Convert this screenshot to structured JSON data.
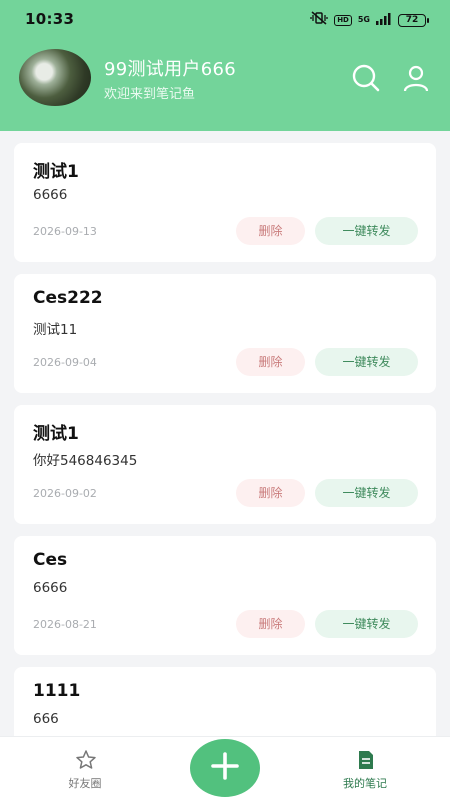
{
  "status_bar": {
    "time": "10:33",
    "network": "5G",
    "hd": "HD",
    "battery": "72"
  },
  "header": {
    "user_name": "99测试用户666",
    "subtitle": "欢迎来到笔记鱼",
    "icons": [
      "search-icon",
      "person-icon"
    ],
    "background_color": "#73d49a"
  },
  "notes": [
    {
      "title": "测试1",
      "body": "6666",
      "date": "2026-09-13",
      "delete_label": "删除",
      "forward_label": "一键转发"
    },
    {
      "title": "Ces222",
      "body": "测试11",
      "date": "2026-09-04",
      "delete_label": "删除",
      "forward_label": "一键转发"
    },
    {
      "title": "测试1",
      "body": "你好546846345",
      "date": "2026-09-02",
      "delete_label": "删除",
      "forward_label": "一键转发"
    },
    {
      "title": "Ces",
      "body": "6666",
      "date": "2026-08-21",
      "delete_label": "删除",
      "forward_label": "一键转发"
    },
    {
      "title": "1111",
      "body": "666",
      "date": "",
      "delete_label": "",
      "forward_label": ""
    }
  ],
  "bottom_nav": {
    "friends_label": "好友圈",
    "notes_label": "我的笔记",
    "add_icon": "plus-icon",
    "accent_color": "#52c17e"
  }
}
